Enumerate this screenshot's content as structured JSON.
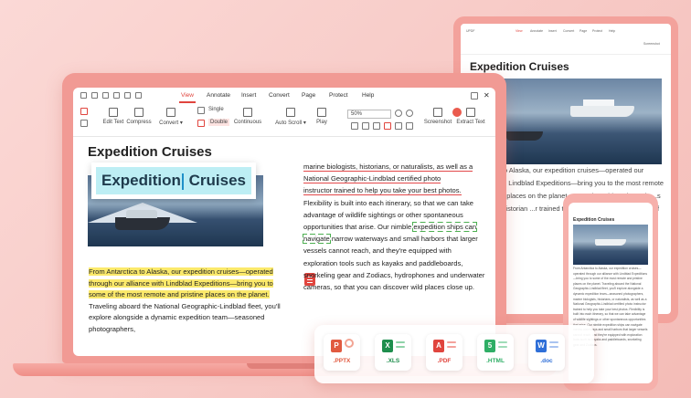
{
  "colors": {
    "accent": "#e0453e",
    "pptx": "#e15a40",
    "xls": "#1e8e4d",
    "pdf": "#e0453e",
    "html": "#2fae66",
    "doc": "#2f6fd8",
    "highlight": "#fbe96b"
  },
  "laptop": {
    "menu": [
      "View",
      "Annotate",
      "Insert",
      "Convert",
      "Page",
      "Protect",
      "Help"
    ],
    "ribbon": {
      "edit_text": "Edit Text",
      "compress": "Compress",
      "convert": "Convert",
      "single": "Single",
      "double": "Double",
      "continuous": "Continuous",
      "auto_scroll": "Auto Scroll",
      "play": "Play",
      "zoom": "50%",
      "screenshot": "Screenshot",
      "extract_text": "Extract Text"
    },
    "doc": {
      "title": "Expedition Cruises",
      "overlay_title_a": "Expedition",
      "overlay_title_b": " Cruises",
      "para1_hl1": "From Antarctica to Alaska, our expedition cruises—operated",
      "para1_hl2": "through our alliance with Lindblad Expeditions—bring you to",
      "para1_hl3": "some of the most remote and pristine places on the planet.",
      "para1_rest": "Traveling aboard the National Geographic-Lindblad fleet, you'll explore alongside a dynamic expedition team—seasoned photographers,",
      "col2_u1": "marine biologists, historians, or naturalists, as well as a",
      "col2_u2": "National Geographic-Lindblad certified photo",
      "col2_u3": "instructor trained to help you take your best photos.",
      "col2_a": "Flexibility is built into each itinerary, so that we can take advantage of wildlife sightings or other spontaneous opportunities that arise. Our nimble",
      "col2_box": "expedition ships can navigate",
      "col2_b": " narrow waterways and small harbors that larger vessels cannot reach, and they're equipped with exploration tools such as kayaks and paddleboards, snorkeling gear and Zodiacs, hydrophones and underwater cameras, so that you can discover wild places close up."
    }
  },
  "tablet": {
    "title": "Expedition Cruises",
    "text": "Antarctica to Alaska, our expedition cruises—operated our alliance with Lindblad Expeditions—bring you to the most remote and pristine places on the planet. ...ore alongside a dynamic ...s ...ologists, historian ...r trained to help ...s built into each ...ge of wildlife s"
  },
  "phone": {
    "title": "Expedition Cruises",
    "text": "From Antarctica to Alaska, our expedition cruises—operated through our alliance with Lindblad Expeditions—bring you to some of the most remote and pristine places on the planet. Traveling aboard the National Geographic-Lindblad fleet, you'll explore alongside a dynamic expedition team—seasoned photographers, marine biologists, historians, or naturalists, as well as a National Geographic-Lindblad certified photo instructor trained to help you take your best photos. Flexibility is built into each itinerary, so that we can take advantage of wildlife sightings or other spontaneous opportunities that arise. Our nimble expedition ships can navigate narrow waterways and small harbors that larger vessels cannot reach, and they're equipped with exploration tools such as kayaks and paddleboards, snorkeling gear and Zodiacs."
  },
  "formats": [
    {
      "label": ".PPTX",
      "badge": "P"
    },
    {
      "label": ".XLS",
      "badge": "X"
    },
    {
      "label": ".PDF",
      "badge": "A"
    },
    {
      "label": ".HTML",
      "badge": "5"
    },
    {
      "label": ".doc",
      "badge": "W"
    }
  ]
}
